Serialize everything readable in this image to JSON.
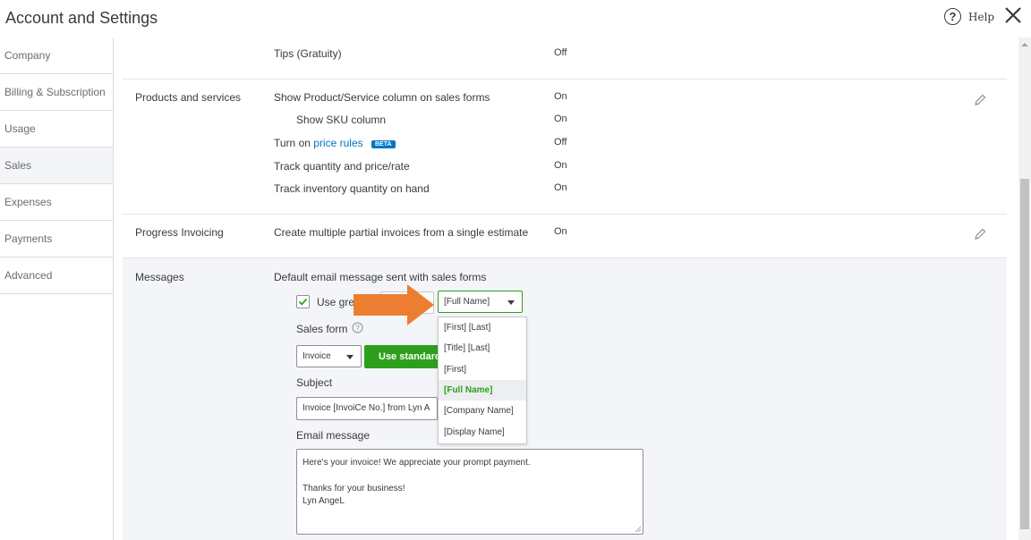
{
  "header": {
    "title": "Account and Settings",
    "help_label": "Help"
  },
  "sidebar": {
    "items": [
      {
        "label": "Company"
      },
      {
        "label": "Billing & Subscription"
      },
      {
        "label": "Usage"
      },
      {
        "label": "Sales",
        "active": true
      },
      {
        "label": "Expenses"
      },
      {
        "label": "Payments"
      },
      {
        "label": "Advanced"
      }
    ]
  },
  "tips": {
    "label": "Tips (Gratuity)",
    "value": "Off"
  },
  "products": {
    "title": "Products and services",
    "rows": [
      {
        "label": "Show Product/Service column on sales forms",
        "value": "On"
      },
      {
        "label": "Show SKU column",
        "value": "On"
      },
      {
        "label_prefix": "Turn on",
        "link": "price rules",
        "badge": "BETA",
        "value": "Off"
      },
      {
        "label": "Track quantity and price/rate",
        "value": "On"
      },
      {
        "label": "Track inventory quantity on hand",
        "value": "On"
      }
    ]
  },
  "progress": {
    "title": "Progress Invoicing",
    "label": "Create multiple partial invoices from a single estimate",
    "value": "On"
  },
  "messages": {
    "title": "Messages",
    "default_label": "Default email message sent with sales forms",
    "use_greeting_label": "Use gre",
    "greeting_name_value": "[Full Name]",
    "sales_form_label": "Sales form",
    "sales_form_value": "Invoice",
    "use_standard_label": "Use standard",
    "subject_label": "Subject",
    "subject_value": "Invoice [InvoiCe No.] from Lyn A",
    "email_label": "Email message",
    "email_line1": "Here's your invoice! We appreciate your prompt payment.",
    "email_line2": "Thanks for your business!",
    "email_line3": "Lyn AngeL"
  },
  "dropdown": {
    "options": [
      {
        "label": "[First] [Last]"
      },
      {
        "label": "[Title] [Last]"
      },
      {
        "label": "[First]"
      },
      {
        "label": "[Full Name]",
        "selected": true
      },
      {
        "label": "[Company Name]"
      },
      {
        "label": "[Display Name]"
      }
    ]
  },
  "colors": {
    "accent_green": "#2ca01c",
    "link_blue": "#0077c5",
    "arrow_orange": "#ed7d31"
  }
}
